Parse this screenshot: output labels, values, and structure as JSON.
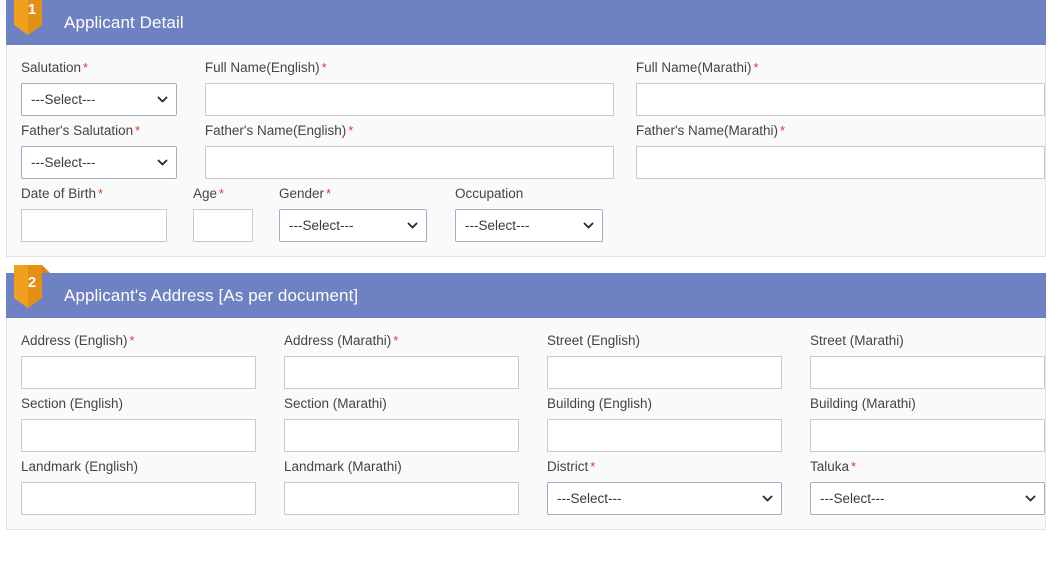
{
  "colors": {
    "header_blue": "#6e81c2",
    "badge_orange": "#f0a01e",
    "badge_orange_dark": "#d98510",
    "required_red": "#e0344a",
    "panel_bg": "#fafafa"
  },
  "select_placeholder": "---Select---",
  "sections": [
    {
      "number": "1",
      "title": "Applicant Detail",
      "rows": [
        {
          "row_class": "s1-r1",
          "fields": [
            {
              "cls": "f-sal",
              "name": "salutation",
              "label": "Salutation",
              "required": true,
              "type": "select",
              "value": "---Select---"
            },
            {
              "cls": "f-fne",
              "name": "full-name-english",
              "label": "Full Name(English)",
              "required": true,
              "type": "text",
              "value": ""
            },
            {
              "cls": "f-fnm",
              "name": "full-name-marathi",
              "label": "Full Name(Marathi)",
              "required": true,
              "type": "text",
              "value": ""
            }
          ]
        },
        {
          "row_class": "s1-r1",
          "fields": [
            {
              "cls": "f-sal",
              "name": "fathers-salutation",
              "label": "Father's Salutation",
              "required": true,
              "type": "select",
              "value": "---Select---"
            },
            {
              "cls": "f-fne",
              "name": "fathers-name-english",
              "label": "Father's Name(English)",
              "required": true,
              "type": "text",
              "value": ""
            },
            {
              "cls": "f-fnm",
              "name": "fathers-name-marathi",
              "label": "Father's Name(Marathi)",
              "required": true,
              "type": "text",
              "value": ""
            }
          ]
        },
        {
          "row_class": "s1-r3",
          "fields": [
            {
              "cls": "f-dob",
              "name": "date-of-birth",
              "label": "Date of Birth",
              "required": true,
              "type": "text",
              "value": ""
            },
            {
              "cls": "f-age",
              "name": "age",
              "label": "Age",
              "required": true,
              "type": "text",
              "value": ""
            },
            {
              "cls": "f-gen",
              "name": "gender",
              "label": "Gender",
              "required": true,
              "type": "select",
              "value": "---Select---"
            },
            {
              "cls": "f-occ",
              "name": "occupation",
              "label": "Occupation",
              "required": false,
              "type": "select",
              "value": "---Select---"
            }
          ]
        }
      ]
    },
    {
      "number": "2",
      "title": "Applicant's Address [As per document]",
      "rows": [
        {
          "row_class": "s2-row",
          "fields": [
            {
              "cls": "f2",
              "name": "address-english",
              "label": "Address (English)",
              "required": true,
              "type": "text",
              "value": ""
            },
            {
              "cls": "f2",
              "name": "address-marathi",
              "label": "Address (Marathi)",
              "required": true,
              "type": "text",
              "value": ""
            },
            {
              "cls": "f2",
              "name": "street-english",
              "label": "Street (English)",
              "required": false,
              "type": "text",
              "value": ""
            },
            {
              "cls": "f2",
              "name": "street-marathi",
              "label": "Street (Marathi)",
              "required": false,
              "type": "text",
              "value": ""
            }
          ]
        },
        {
          "row_class": "s2-row",
          "fields": [
            {
              "cls": "f2",
              "name": "section-english",
              "label": "Section (English)",
              "required": false,
              "type": "text",
              "value": ""
            },
            {
              "cls": "f2",
              "name": "section-marathi",
              "label": "Section (Marathi)",
              "required": false,
              "type": "text",
              "value": ""
            },
            {
              "cls": "f2",
              "name": "building-english",
              "label": "Building (English)",
              "required": false,
              "type": "text",
              "value": ""
            },
            {
              "cls": "f2",
              "name": "building-marathi",
              "label": "Building (Marathi)",
              "required": false,
              "type": "text",
              "value": ""
            }
          ]
        },
        {
          "row_class": "s2-row",
          "fields": [
            {
              "cls": "f2",
              "name": "landmark-english",
              "label": "Landmark (English)",
              "required": false,
              "type": "text",
              "value": ""
            },
            {
              "cls": "f2",
              "name": "landmark-marathi",
              "label": "Landmark (Marathi)",
              "required": false,
              "type": "text",
              "value": ""
            },
            {
              "cls": "f2",
              "name": "district",
              "label": "District",
              "required": true,
              "type": "select",
              "value": "---Select---"
            },
            {
              "cls": "f2",
              "name": "taluka",
              "label": "Taluka",
              "required": true,
              "type": "select",
              "value": "---Select---"
            }
          ]
        }
      ]
    }
  ]
}
